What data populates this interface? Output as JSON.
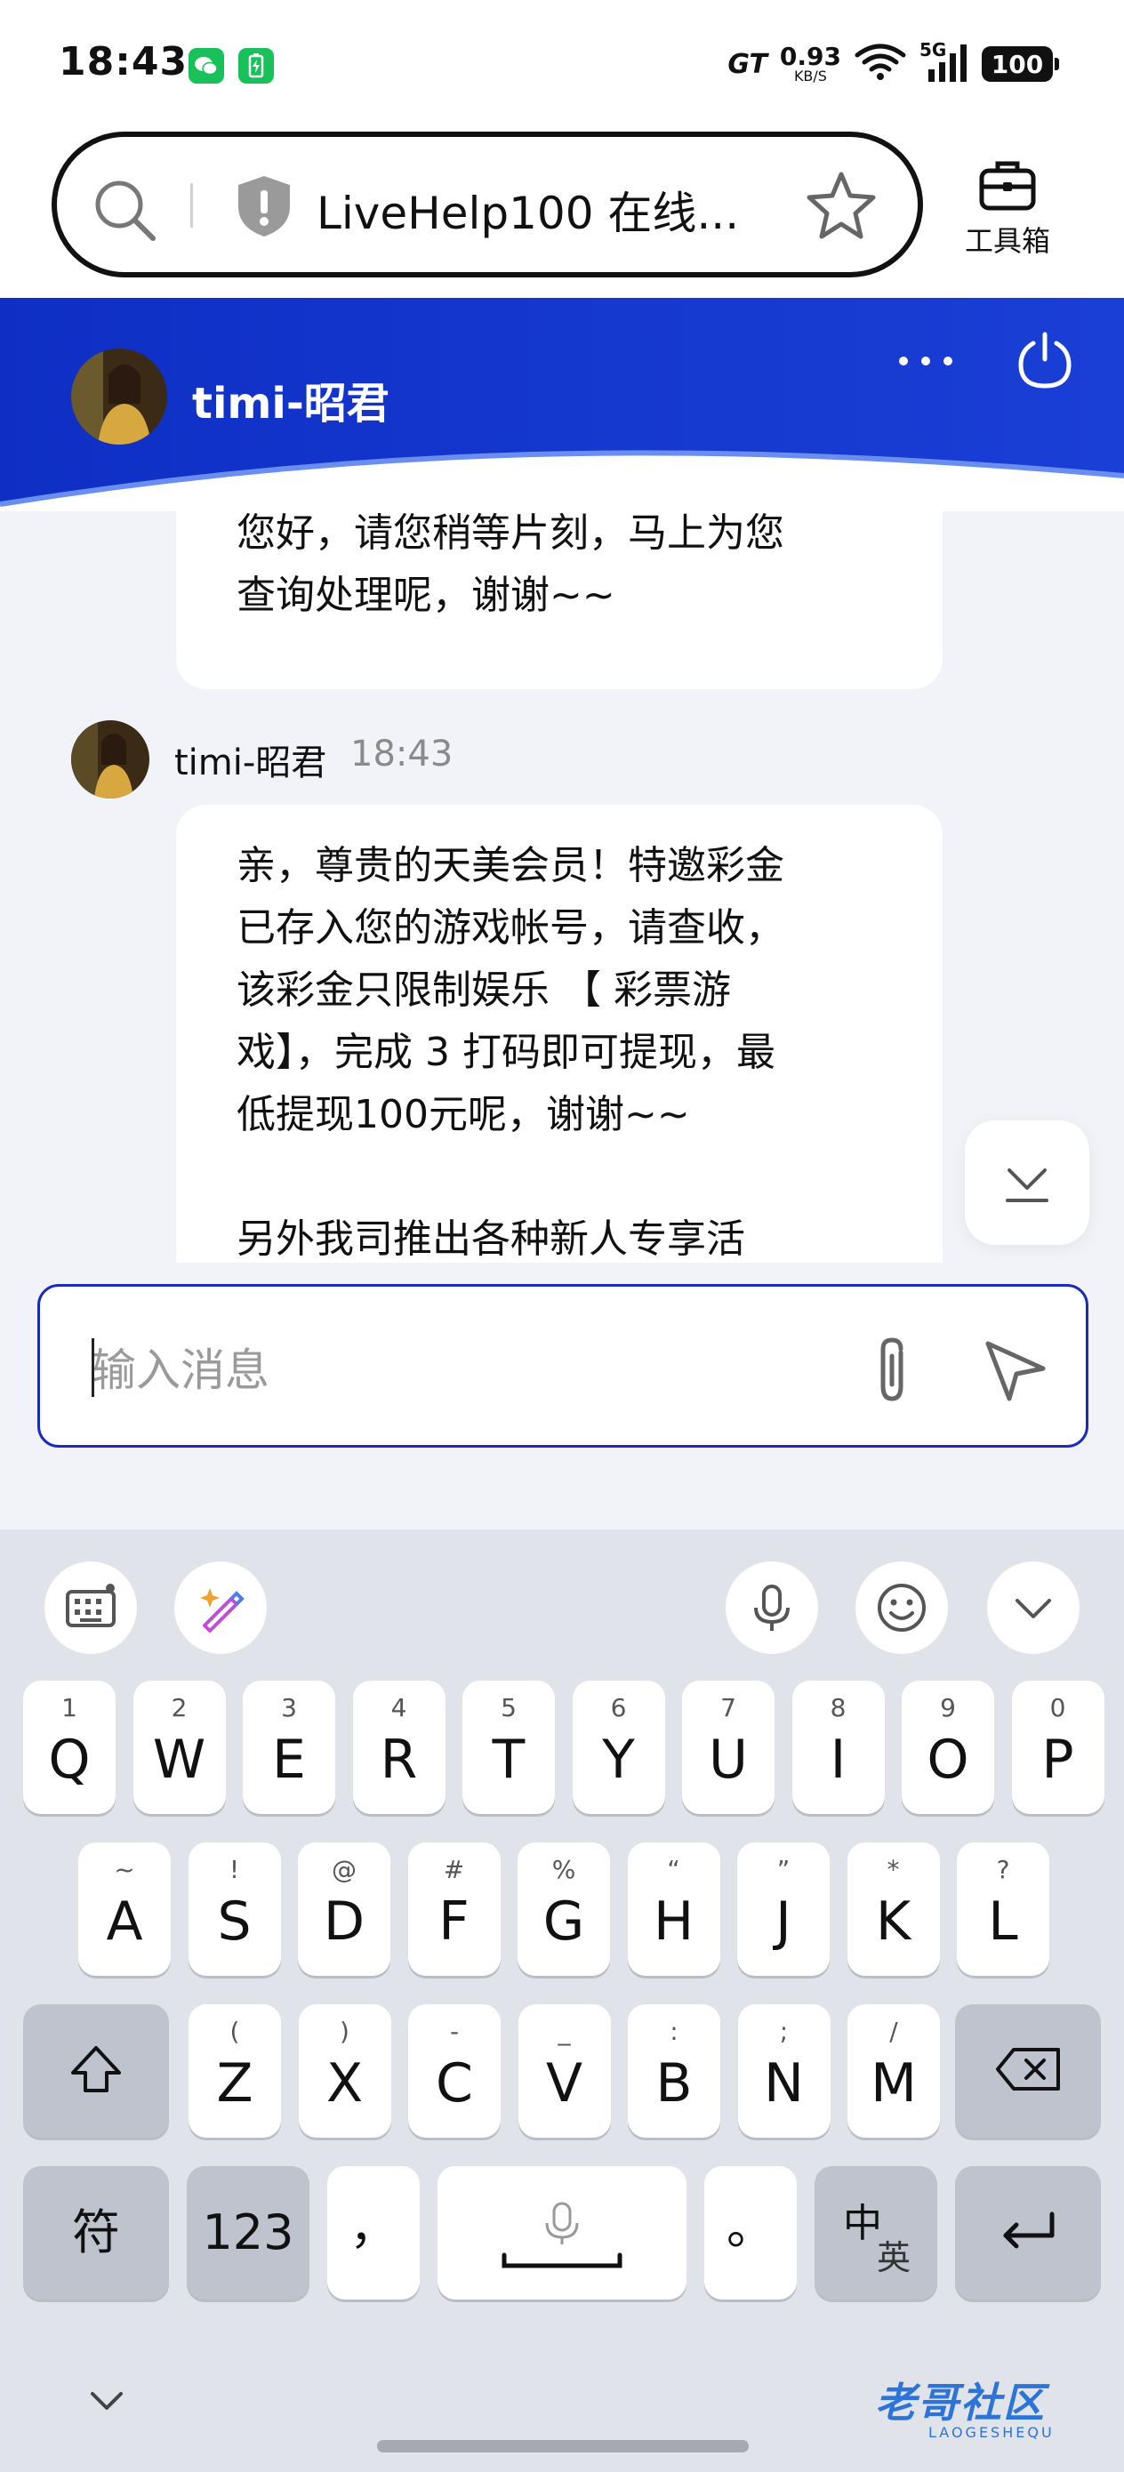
{
  "status_bar": {
    "time": "18:43",
    "gt_label": "GT",
    "net_speed": "0.93",
    "net_unit": "KB/S",
    "signal_label": "5G",
    "battery": "100",
    "icons": [
      "wechat-icon",
      "battery-saver-icon",
      "wifi-icon",
      "cell-signal-icon"
    ]
  },
  "browser": {
    "url_title": "LiveHelp100 在线...",
    "toolbox_label": "工具箱",
    "icons": [
      "search-icon",
      "shield-icon",
      "star-icon",
      "toolbox-icon"
    ]
  },
  "chat_header": {
    "agent_name": "timi-昭君",
    "accent_color": "#1a35c9",
    "icons": [
      "more-icon",
      "power-icon"
    ]
  },
  "messages": [
    {
      "lines": [
        "您好，请您稍等片刻，马上为您",
        "查询处理呢，谢谢~~"
      ]
    },
    {
      "sender": "timi-昭君",
      "time": "18:43",
      "lines": [
        "亲，尊贵的天美会员！特邀彩金",
        "已存入您的游戏帐号，请查收，",
        "该彩金只限制娱乐 【 彩票游",
        "戏】，完成 3 打码即可提现，最",
        "低提现100元呢，谢谢~~"
      ],
      "lines_after_gap": [
        "另外我司推出各种新人专享活"
      ]
    }
  ],
  "composer": {
    "placeholder": "输入消息",
    "icons": [
      "attach-icon",
      "send-icon"
    ]
  },
  "keyboard": {
    "row1": [
      {
        "hint": "1",
        "key": "Q"
      },
      {
        "hint": "2",
        "key": "W"
      },
      {
        "hint": "3",
        "key": "E"
      },
      {
        "hint": "4",
        "key": "R"
      },
      {
        "hint": "5",
        "key": "T"
      },
      {
        "hint": "6",
        "key": "Y"
      },
      {
        "hint": "7",
        "key": "U"
      },
      {
        "hint": "8",
        "key": "I"
      },
      {
        "hint": "9",
        "key": "O"
      },
      {
        "hint": "0",
        "key": "P"
      }
    ],
    "row2": [
      {
        "hint": "~",
        "key": "A"
      },
      {
        "hint": "!",
        "key": "S"
      },
      {
        "hint": "@",
        "key": "D"
      },
      {
        "hint": "#",
        "key": "F"
      },
      {
        "hint": "%",
        "key": "G"
      },
      {
        "hint": "“",
        "key": "H"
      },
      {
        "hint": "”",
        "key": "J"
      },
      {
        "hint": "*",
        "key": "K"
      },
      {
        "hint": "?",
        "key": "L"
      }
    ],
    "row3": [
      {
        "hint": "(",
        "key": "Z"
      },
      {
        "hint": ")",
        "key": "X"
      },
      {
        "hint": "-",
        "key": "C"
      },
      {
        "hint": "_",
        "key": "V"
      },
      {
        "hint": ":",
        "key": "B"
      },
      {
        "hint": ";",
        "key": "N"
      },
      {
        "hint": "/",
        "key": "M"
      }
    ],
    "symbols_key": "符",
    "numbers_key": "123",
    "comma_key": "，",
    "period_key": "。",
    "lang_key_top": "中",
    "lang_key_bottom": "英"
  },
  "watermark": {
    "text": "老哥社区",
    "sub": "LAOGESHEQU"
  }
}
